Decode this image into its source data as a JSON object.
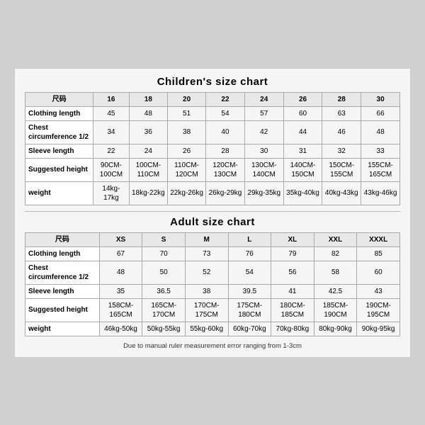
{
  "children_chart": {
    "title": "Children's size chart",
    "headers": [
      "尺码",
      "16",
      "18",
      "20",
      "22",
      "24",
      "26",
      "28",
      "30"
    ],
    "rows": [
      {
        "label": "Clothing length",
        "values": [
          "45",
          "48",
          "51",
          "54",
          "57",
          "60",
          "63",
          "66"
        ]
      },
      {
        "label": "Chest circumference 1/2",
        "values": [
          "34",
          "36",
          "38",
          "40",
          "42",
          "44",
          "46",
          "48"
        ]
      },
      {
        "label": "Sleeve length",
        "values": [
          "22",
          "24",
          "26",
          "28",
          "30",
          "31",
          "32",
          "33"
        ]
      },
      {
        "label": "Suggested height",
        "values": [
          "90CM-100CM",
          "100CM-110CM",
          "110CM-120CM",
          "120CM-130CM",
          "130CM-140CM",
          "140CM-150CM",
          "150CM-155CM",
          "155CM-165CM"
        ]
      },
      {
        "label": "weight",
        "values": [
          "14kg-17kg",
          "18kg-22kg",
          "22kg-26kg",
          "26kg-29kg",
          "29kg-35kg",
          "35kg-40kg",
          "40kg-43kg",
          "43kg-46kg"
        ]
      }
    ]
  },
  "adult_chart": {
    "title": "Adult size chart",
    "headers": [
      "尺码",
      "XS",
      "S",
      "M",
      "L",
      "XL",
      "XXL",
      "XXXL"
    ],
    "rows": [
      {
        "label": "Clothing length",
        "values": [
          "67",
          "70",
          "73",
          "76",
          "79",
          "82",
          "85"
        ]
      },
      {
        "label": "Chest circumference 1/2",
        "values": [
          "48",
          "50",
          "52",
          "54",
          "56",
          "58",
          "60"
        ]
      },
      {
        "label": "Sleeve length",
        "values": [
          "35",
          "36.5",
          "38",
          "39.5",
          "41",
          "42.5",
          "43"
        ]
      },
      {
        "label": "Suggested height",
        "values": [
          "158CM-165CM",
          "165CM-170CM",
          "170CM-175CM",
          "175CM-180CM",
          "180CM-185CM",
          "185CM-190CM",
          "190CM-195CM"
        ]
      },
      {
        "label": "weight",
        "values": [
          "46kg-50kg",
          "50kg-55kg",
          "55kg-60kg",
          "60kg-70kg",
          "70kg-80kg",
          "80kg-90kg",
          "90kg-95kg"
        ]
      }
    ]
  },
  "note": "Due to manual ruler measurement error ranging from 1-3cm"
}
